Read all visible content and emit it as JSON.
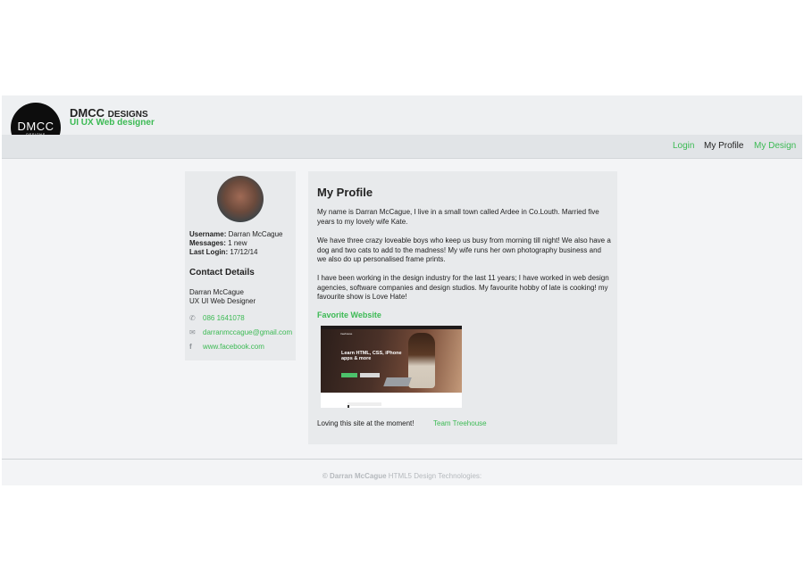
{
  "header": {
    "logo_text": "DMCC",
    "logo_subtext": "DESIGNS",
    "brand_main": "DMCC",
    "brand_small": "DESIGNS",
    "tagline": "UI UX Web designer"
  },
  "nav": {
    "items": [
      {
        "label": "Login",
        "active": false
      },
      {
        "label": "My Profile",
        "active": true
      },
      {
        "label": "My Design",
        "active": false
      }
    ]
  },
  "sidebar": {
    "username_label": "Username:",
    "username": "Darran McCague",
    "messages_label": "Messages:",
    "messages": "1 new",
    "last_login_label": "Last Login:",
    "last_login": "17/12/14",
    "contact_heading": "Contact Details",
    "name": "Darran McCague",
    "role": "UX UI Web Designer",
    "phone_icon": "phone-icon",
    "phone": "086 1641078",
    "email_icon": "mail-icon",
    "email": "darranmccague@gmail.com",
    "facebook_icon": "facebook-icon",
    "facebook": "www.facebook.com"
  },
  "main": {
    "title": "My Profile",
    "paragraphs": [
      "My name is Darran McCague, I live in a small town called Ardee in Co.Louth. Married five years to my lovely wife Kate.",
      "We have three crazy loveable boys who keep us busy from morning till night! We also have a dog and two cats to add to the madness! My wife runs her own photography business and we also do up personalised frame prints.",
      "I have been working in the design industry for the last 11 years; I have worked in web design agencies, software companies and design studios. My favourite hobby of late is cooking! my favourite show is Love Hate!"
    ],
    "favorite_heading": "Favorite Website",
    "screenshot": {
      "logo": "treehouse",
      "headline_line1": "Learn HTML, CSS, iPhone",
      "headline_line2": "apps & more"
    },
    "loving_text": "Loving this site at the moment!",
    "loving_link": "Team Treehouse"
  },
  "footer": {
    "copyright_name": "© Darran McCague",
    "tech_text": "HTML5 Design Technologies:"
  },
  "colors": {
    "accent": "#3cba54",
    "header_bg": "#eef0f2",
    "nav_bg": "#e1e4e7",
    "panel_bg": "#e8eaec"
  }
}
